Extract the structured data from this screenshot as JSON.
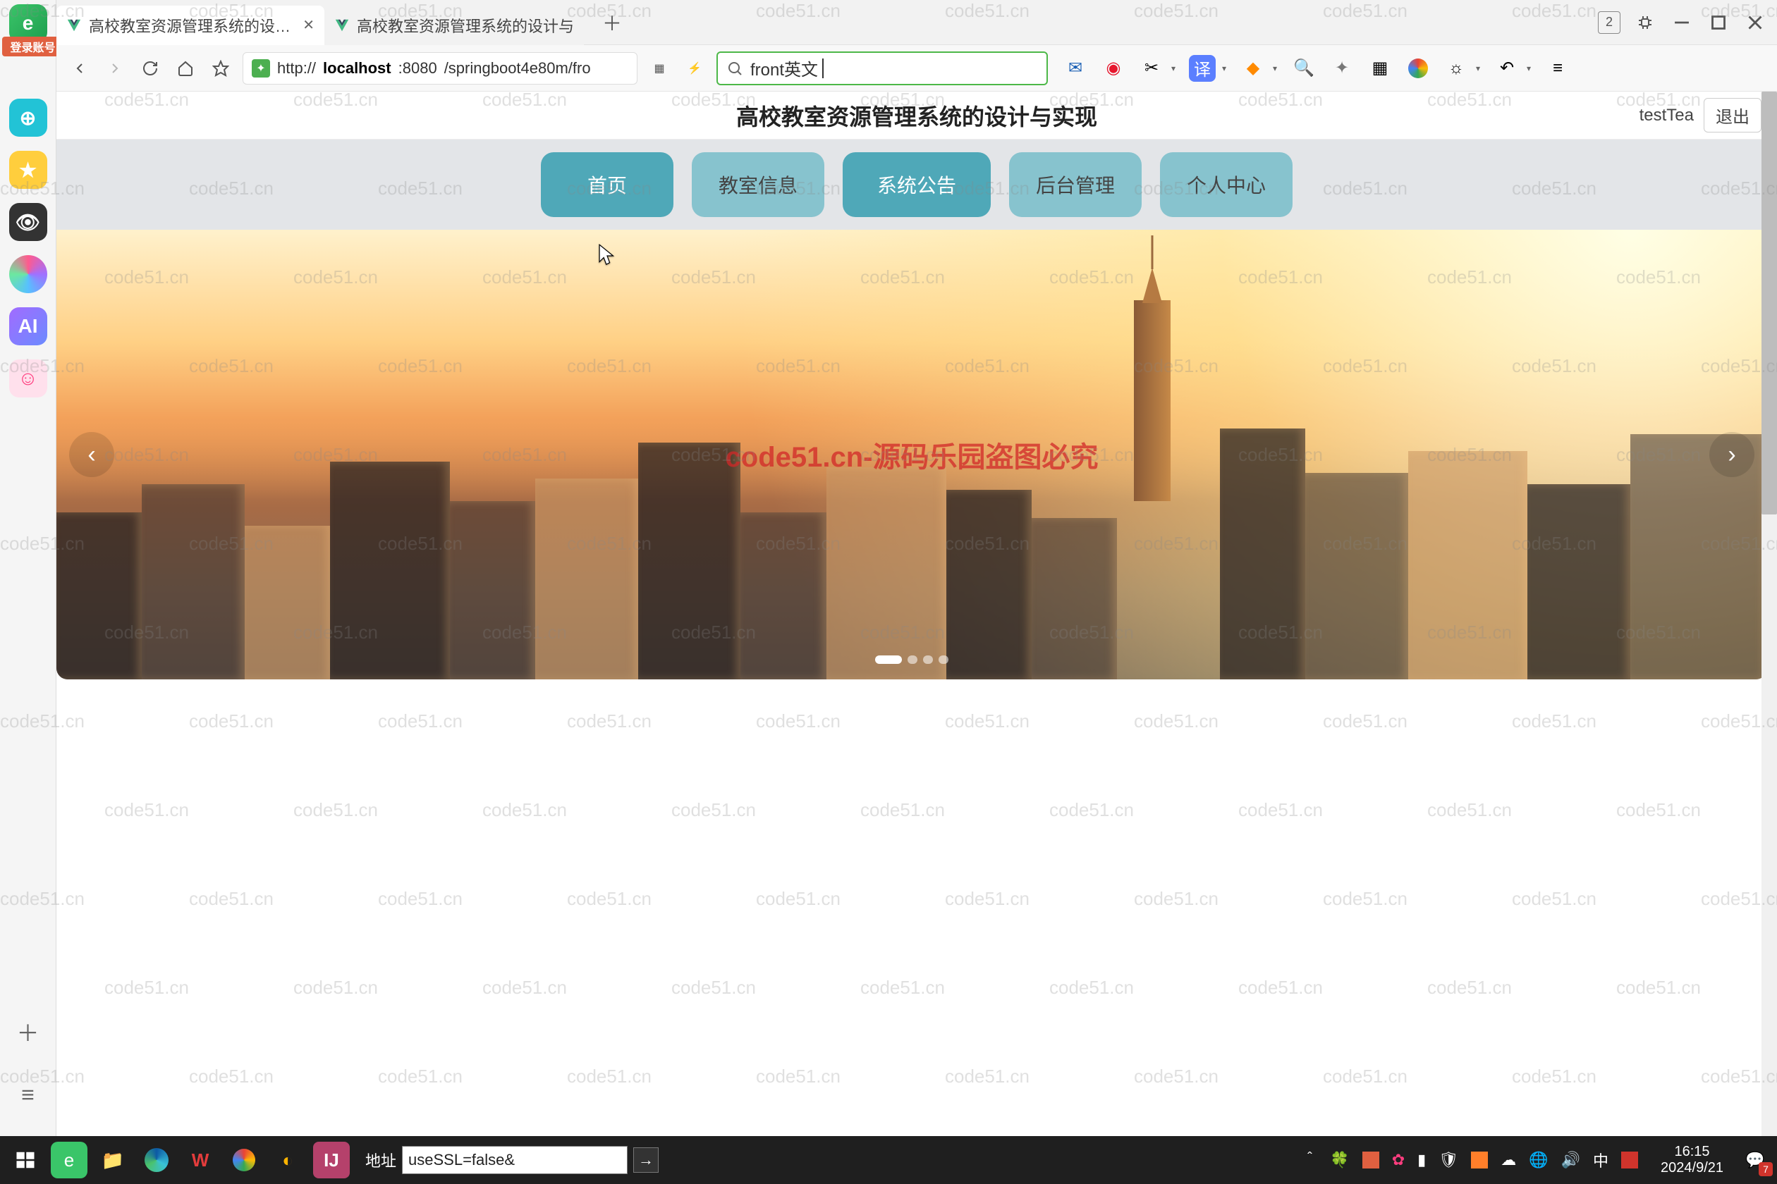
{
  "browser": {
    "tabs": [
      {
        "title": "高校教室资源管理系统的设计与",
        "active": true
      },
      {
        "title": "高校教室资源管理系统的设计与",
        "active": false
      }
    ],
    "tab_counter": "2",
    "url": {
      "prefix": "http://",
      "host": "localhost",
      "port": ":8080",
      "path": "/springboot4e80m/fro"
    },
    "search": {
      "value": "front英文"
    }
  },
  "sidebar_badge": "登录账号",
  "page": {
    "title": "高校教室资源管理系统的设计与实现",
    "user": "testTea",
    "logout": "退出",
    "nav": [
      {
        "label": "首页",
        "active": true
      },
      {
        "label": "教室信息",
        "active": false
      },
      {
        "label": "系统公告",
        "active": true
      },
      {
        "label": "后台管理",
        "active": false
      },
      {
        "label": "个人中心",
        "active": false
      }
    ],
    "hero_watermark": "code51.cn-源码乐园盗图必究",
    "carousel": {
      "count": 4,
      "active_index": 0
    }
  },
  "watermark_text": "code51.cn",
  "taskbar": {
    "addr_label": "地址",
    "addr_value": "useSSL=false&",
    "clock_time": "16:15",
    "clock_date": "2024/9/21",
    "ime": "中",
    "notif_count": "7"
  }
}
